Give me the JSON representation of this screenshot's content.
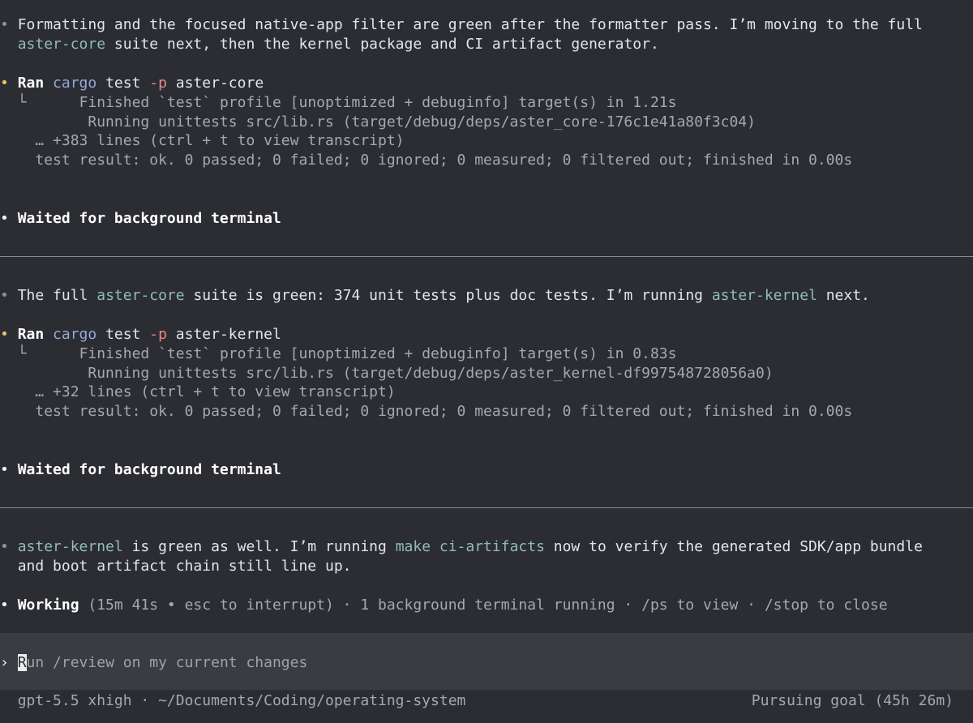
{
  "bullet": "•",
  "blocks": {
    "msg1": {
      "line1": "Formatting and the focused native-app filter are green after the formatter pass. I’m moving to the full",
      "line2_hl": "aster-core",
      "line2_rest": " suite next, then the kernel package and CI artifact generator."
    },
    "run1": {
      "ran": "Ran",
      "cmd": "cargo",
      "sub": " test ",
      "flag": "-p",
      "pkg": " aster-core",
      "tree": "└",
      "out1": "    Finished `test` profile [unoptimized + debuginfo] target(s) in 1.21s",
      "out2": "     Running unittests src/lib.rs (target/debug/deps/aster_core-176c1e41a80f3c04)",
      "more": "… +383 lines (ctrl + t to view transcript)",
      "result": "test result: ok. 0 passed; 0 failed; 0 ignored; 0 measured; 0 filtered out; finished in 0.00s"
    },
    "wait1": "Waited for background terminal",
    "msg2": {
      "a": "The full ",
      "hl1": "aster-core",
      "b": " suite is green: 374 unit tests plus doc tests. I’m running ",
      "hl2": "aster-kernel",
      "c": " next."
    },
    "run2": {
      "ran": "Ran",
      "cmd": "cargo",
      "sub": " test ",
      "flag": "-p",
      "pkg": " aster-kernel",
      "tree": "└",
      "out1": "    Finished `test` profile [unoptimized + debuginfo] target(s) in 0.83s",
      "out2": "     Running unittests src/lib.rs (target/debug/deps/aster_kernel-df997548728056a0)",
      "more": "… +32 lines (ctrl + t to view transcript)",
      "result": "test result: ok. 0 passed; 0 failed; 0 ignored; 0 measured; 0 filtered out; finished in 0.00s"
    },
    "wait2": "Waited for background terminal",
    "msg3": {
      "hl1": "aster-kernel",
      "a": " is green as well. I’m running ",
      "hl2": "make ci-artifacts",
      "b": " now to verify the generated SDK/app bundle",
      "line2": "and boot artifact chain still line up."
    },
    "status": {
      "label": "Working",
      "detail": " (15m 41s • esc to interrupt) · 1 background terminal running · /ps to view · /stop to close"
    }
  },
  "composer": {
    "prompt": "›",
    "cursor_char": "R",
    "placeholder_rest": "un /review on my current changes"
  },
  "footer": {
    "left": "gpt-5.5 xhigh · ~/Documents/Coding/operating-system",
    "right": "Pursuing goal (45h 26m)"
  }
}
